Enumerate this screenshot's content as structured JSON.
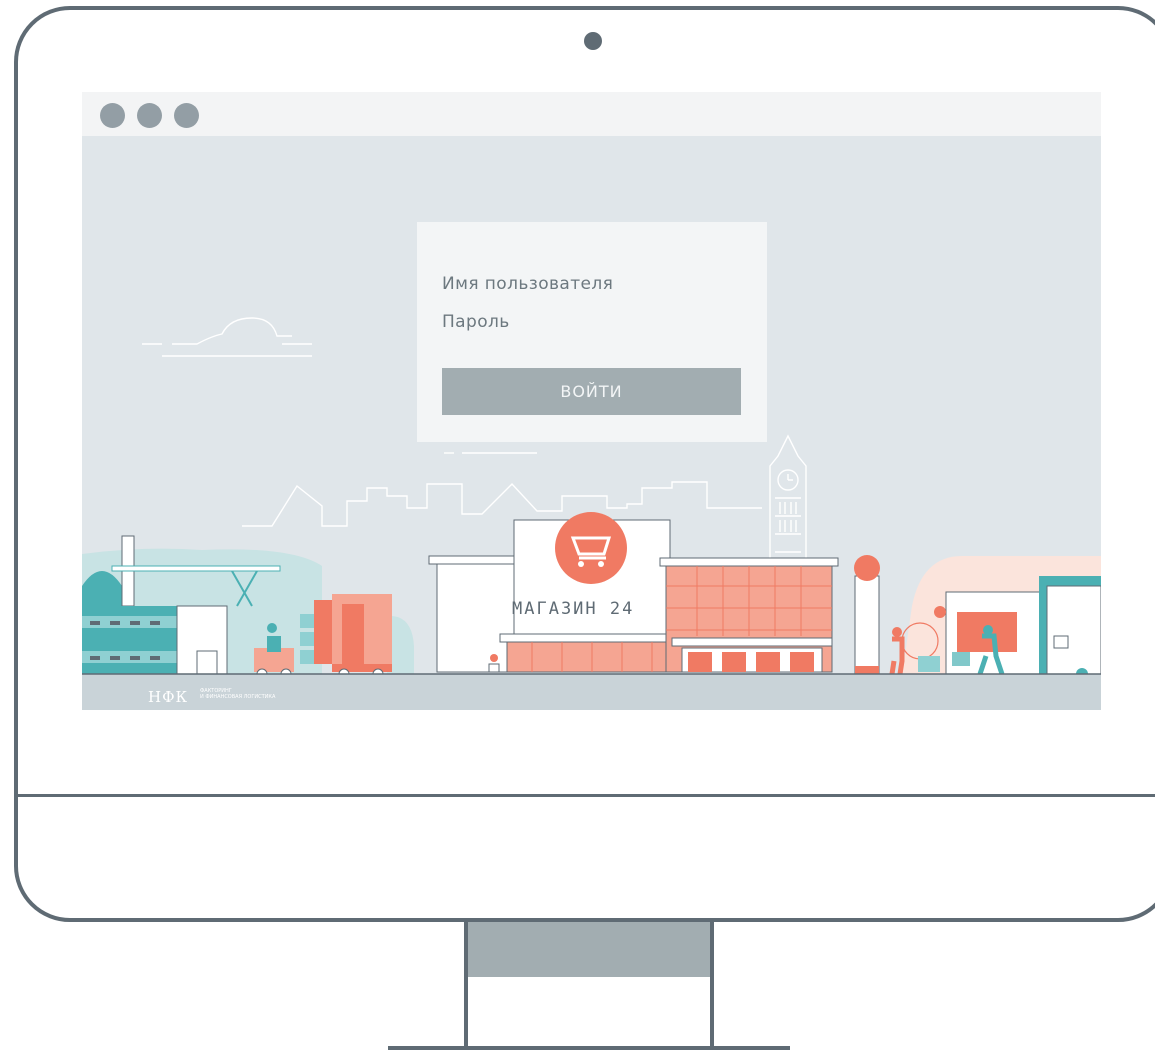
{
  "login": {
    "username_placeholder": "Имя пользователя",
    "password_placeholder": "Пароль",
    "submit_label": "ВОЙТИ"
  },
  "store_sign": "МАГАЗИН 24",
  "logo": {
    "name": "НФК",
    "tagline_line1": "ФАКТОРИНГ",
    "tagline_line2": "И ФИНАНСОВАЯ ЛОГИСТИКА"
  },
  "colors": {
    "frame": "#5f6b74",
    "accent": "#f07a63",
    "teal": "#4bb0b3",
    "button": "#a2adb1",
    "background": "#e0e6ea"
  }
}
